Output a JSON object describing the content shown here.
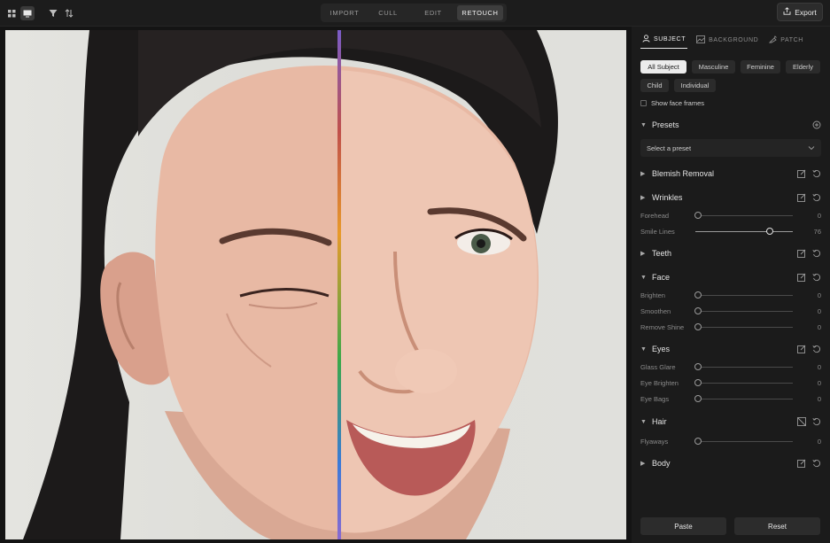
{
  "toolbar": {
    "icons": [
      "grid-icon",
      "single-view-icon",
      "filter-icon",
      "sort-icon"
    ],
    "modes": [
      {
        "label": "IMPORT",
        "active": false
      },
      {
        "label": "CULL",
        "active": false
      },
      {
        "label": "EDIT",
        "active": false
      },
      {
        "label": "RETOUCH",
        "active": true
      }
    ],
    "export_label": "Export"
  },
  "panel": {
    "tabs": [
      {
        "label": "SUBJECT",
        "icon": "person-icon",
        "active": true
      },
      {
        "label": "BACKGROUND",
        "icon": "image-icon",
        "active": false
      },
      {
        "label": "PATCH",
        "icon": "patch-icon",
        "active": false
      }
    ],
    "subject_filters": [
      {
        "label": "All Subject",
        "active": true
      },
      {
        "label": "Masculine",
        "active": false
      },
      {
        "label": "Feminine",
        "active": false
      },
      {
        "label": "Elderly",
        "active": false
      },
      {
        "label": "Child",
        "active": false
      },
      {
        "label": "Individual",
        "active": false
      }
    ],
    "show_face_frames": {
      "label": "Show face frames",
      "checked": false
    },
    "presets": {
      "title": "Presets",
      "placeholder": "Select a preset"
    },
    "sections": {
      "blemish": {
        "title": "Blemish Removal"
      },
      "wrinkles": {
        "title": "Wrinkles",
        "sliders": [
          {
            "label": "Forehead",
            "value": 0
          },
          {
            "label": "Smile Lines",
            "value": 76
          }
        ]
      },
      "teeth": {
        "title": "Teeth"
      },
      "face": {
        "title": "Face",
        "sliders": [
          {
            "label": "Brighten",
            "value": 0
          },
          {
            "label": "Smoothen",
            "value": 0
          },
          {
            "label": "Remove Shine",
            "value": 0
          }
        ]
      },
      "eyes": {
        "title": "Eyes",
        "sliders": [
          {
            "label": "Glass Glare",
            "value": 0
          },
          {
            "label": "Eye Brighten",
            "value": 0
          },
          {
            "label": "Eye Bags",
            "value": 0
          }
        ]
      },
      "hair": {
        "title": "Hair",
        "sliders": [
          {
            "label": "Flyaways",
            "value": 0
          }
        ]
      },
      "body": {
        "title": "Body"
      }
    },
    "paste_label": "Paste",
    "reset_label": "Reset"
  },
  "colors": {
    "split_line": "#e89a2a",
    "panel_bg": "#1b1b1b",
    "accent_active": "#ececec"
  }
}
